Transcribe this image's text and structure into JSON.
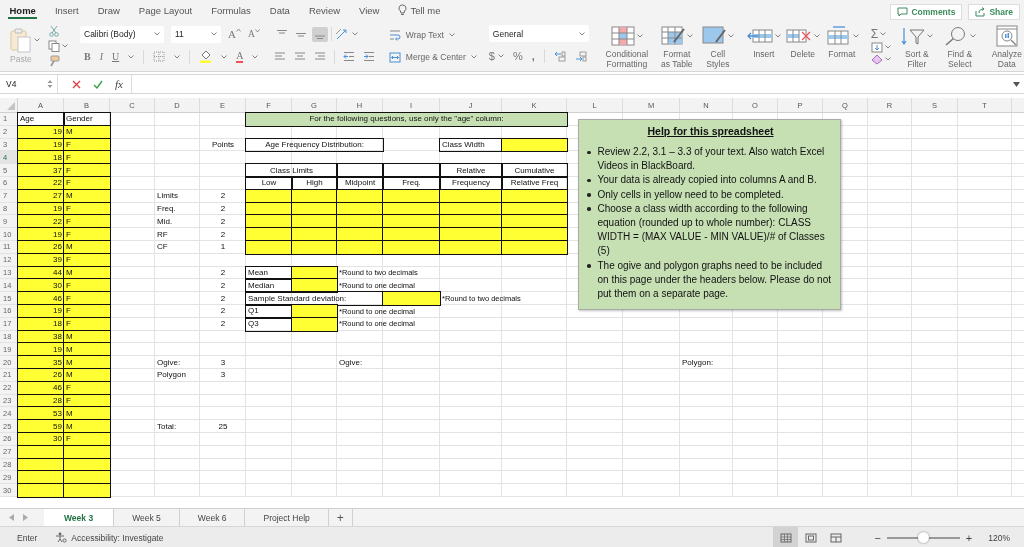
{
  "ribbon_tabs": [
    {
      "label": "Home",
      "kind": "tab",
      "selected": true
    },
    {
      "label": "Insert",
      "kind": "tab",
      "selected": false
    },
    {
      "label": "Draw",
      "kind": "tab",
      "selected": false
    },
    {
      "label": "Page Layout",
      "kind": "tab",
      "selected": false
    },
    {
      "label": "Formulas",
      "kind": "tab",
      "selected": false
    },
    {
      "label": "Data",
      "kind": "tab",
      "selected": false
    },
    {
      "label": "Review",
      "kind": "tab",
      "selected": false
    },
    {
      "label": "View",
      "kind": "tab",
      "selected": false
    },
    {
      "label": "Tell me",
      "kind": "search",
      "selected": false
    }
  ],
  "top_buttons": [
    {
      "label": "Comments",
      "kind": "comments"
    },
    {
      "label": "Share",
      "kind": "share"
    }
  ],
  "ribbon": {
    "paste": "Paste",
    "font_name": "Calibri (Body)",
    "font_size": "11",
    "increase_font": "A",
    "decrease_font": "A",
    "bold": "B",
    "italic": "I",
    "underline": "U",
    "font_color": "A",
    "vertical_align": [
      {
        "kind": "top",
        "selected": false
      },
      {
        "kind": "middle",
        "selected": false
      },
      {
        "kind": "bottom",
        "selected": true
      }
    ],
    "wrap_text": "Wrap Text",
    "merge_center": "Merge & Center",
    "number_format": "General",
    "currency": "$",
    "percent": "%",
    "comma": ",",
    "style_buttons": [
      {
        "label": "Conditional Formatting",
        "kind": "conditional"
      },
      {
        "label": "Format as Table",
        "kind": "table"
      },
      {
        "label": "Cell Styles",
        "kind": "styles"
      }
    ],
    "cell_buttons": [
      {
        "label": "Insert",
        "kind": "insert"
      },
      {
        "label": "Delete",
        "kind": "delete"
      },
      {
        "label": "Format",
        "kind": "format"
      }
    ],
    "autosum": "Σ",
    "edit_buttons": [
      {
        "label": "Sort & Filter",
        "kind": "sort"
      },
      {
        "label": "Find & Select",
        "kind": "find"
      }
    ],
    "analyze": "Analyze Data"
  },
  "formula_bar": {
    "name_box": "V4",
    "function_label": "fx"
  },
  "sheet": {
    "columns": [
      "A",
      "B",
      "C",
      "D",
      "E",
      "F",
      "G",
      "H",
      "I",
      "J",
      "K",
      "L",
      "M",
      "N",
      "O",
      "P",
      "Q",
      "R",
      "S",
      "T"
    ],
    "rows": [
      {
        "number": "1",
        "selected": false,
        "cells": [
          {
            "kind": "header",
            "text": "Age"
          },
          {
            "kind": "header",
            "text": "Gender"
          },
          "",
          "",
          "",
          {
            "kind": "banner",
            "text": "For the following questions, use only the \"age\" column:"
          },
          {
            "kind": "merged"
          },
          {
            "kind": "merged"
          },
          {
            "kind": "merged"
          },
          {
            "kind": "merged"
          },
          {
            "kind": "merged"
          }
        ]
      },
      {
        "number": "2",
        "selected": false,
        "cells": [
          {
            "kind": "entry",
            "text": "19"
          },
          {
            "kind": "entry-text",
            "text": "M"
          }
        ]
      },
      {
        "number": "3",
        "selected": false,
        "cells": [
          {
            "kind": "entry",
            "text": "19"
          },
          {
            "kind": "entry-text",
            "text": "F"
          },
          "",
          "",
          {
            "kind": "centered",
            "text": "Points"
          },
          {
            "kind": "box-center",
            "text": "Age Frequency Distribution:"
          },
          {
            "kind": "merged"
          },
          {
            "kind": "merged"
          },
          "",
          {
            "kind": "box",
            "text": "Class Width"
          },
          {
            "kind": "entry"
          }
        ]
      },
      {
        "number": "4",
        "selected": true,
        "cells": [
          {
            "kind": "entry",
            "text": "18"
          },
          {
            "kind": "entry-text",
            "text": "F"
          }
        ]
      },
      {
        "number": "5",
        "selected": false,
        "cells": [
          {
            "kind": "entry",
            "text": "37"
          },
          {
            "kind": "entry-text",
            "text": "F"
          },
          "",
          "",
          "",
          {
            "kind": "box-center",
            "text": "Class Limits"
          },
          {
            "kind": "merged"
          },
          {
            "kind": "box-center"
          },
          {
            "kind": "box-center"
          },
          {
            "kind": "box-center",
            "text": "Relative"
          },
          {
            "kind": "box-center",
            "text": "Cumulative"
          }
        ]
      },
      {
        "number": "6",
        "selected": false,
        "cells": [
          {
            "kind": "entry",
            "text": "22"
          },
          {
            "kind": "entry-text",
            "text": "F"
          },
          "",
          "",
          "",
          {
            "kind": "box-center",
            "text": "Low"
          },
          {
            "kind": "box-center",
            "text": "High"
          },
          {
            "kind": "box-center",
            "text": "Midpoint"
          },
          {
            "kind": "box-center",
            "text": "Freq."
          },
          {
            "kind": "box-center",
            "text": "Frequency"
          },
          {
            "kind": "box-center",
            "text": "Relative Freq"
          }
        ]
      },
      {
        "number": "7",
        "selected": false,
        "cells": [
          {
            "kind": "entry",
            "text": "27"
          },
          {
            "kind": "entry-text",
            "text": "M"
          },
          "",
          {
            "kind": "label",
            "text": "Limits"
          },
          {
            "kind": "centered",
            "text": "2"
          },
          {
            "kind": "entry"
          },
          {
            "kind": "entry"
          },
          {
            "kind": "entry"
          },
          {
            "kind": "entry"
          },
          {
            "kind": "entry"
          },
          {
            "kind": "entry"
          }
        ]
      },
      {
        "number": "8",
        "selected": false,
        "cells": [
          {
            "kind": "entry",
            "text": "19"
          },
          {
            "kind": "entry-text",
            "text": "F"
          },
          "",
          {
            "kind": "label",
            "text": "Freq."
          },
          {
            "kind": "centered",
            "text": "2"
          },
          {
            "kind": "entry"
          },
          {
            "kind": "entry"
          },
          {
            "kind": "entry"
          },
          {
            "kind": "entry"
          },
          {
            "kind": "entry"
          },
          {
            "kind": "entry"
          }
        ]
      },
      {
        "number": "9",
        "selected": false,
        "cells": [
          {
            "kind": "entry",
            "text": "22"
          },
          {
            "kind": "entry-text",
            "text": "F"
          },
          "",
          {
            "kind": "label",
            "text": "Mid."
          },
          {
            "kind": "centered",
            "text": "2"
          },
          {
            "kind": "entry"
          },
          {
            "kind": "entry"
          },
          {
            "kind": "entry"
          },
          {
            "kind": "entry"
          },
          {
            "kind": "entry"
          },
          {
            "kind": "entry"
          }
        ]
      },
      {
        "number": "10",
        "selected": false,
        "cells": [
          {
            "kind": "entry",
            "text": "19"
          },
          {
            "kind": "entry-text",
            "text": "F"
          },
          "",
          {
            "kind": "label",
            "text": "RF"
          },
          {
            "kind": "centered",
            "text": "2"
          },
          {
            "kind": "entry"
          },
          {
            "kind": "entry"
          },
          {
            "kind": "entry"
          },
          {
            "kind": "entry"
          },
          {
            "kind": "entry"
          },
          {
            "kind": "entry"
          }
        ]
      },
      {
        "number": "11",
        "selected": false,
        "cells": [
          {
            "kind": "entry",
            "text": "26"
          },
          {
            "kind": "entry-text",
            "text": "M"
          },
          "",
          {
            "kind": "label",
            "text": "CF"
          },
          {
            "kind": "centered",
            "text": "1"
          },
          {
            "kind": "entry"
          },
          {
            "kind": "entry"
          },
          {
            "kind": "entry"
          },
          {
            "kind": "entry"
          },
          {
            "kind": "entry"
          },
          {
            "kind": "entry"
          }
        ]
      },
      {
        "number": "12",
        "selected": false,
        "cells": [
          {
            "kind": "entry",
            "text": "39"
          },
          {
            "kind": "entry-text",
            "text": "F"
          }
        ]
      },
      {
        "number": "13",
        "selected": false,
        "cells": [
          {
            "kind": "entry",
            "text": "44"
          },
          {
            "kind": "entry-text",
            "text": "M"
          },
          "",
          "",
          {
            "kind": "centered",
            "text": "2"
          },
          {
            "kind": "box",
            "text": "Mean"
          },
          {
            "kind": "entry"
          },
          {
            "kind": "note",
            "text": "*Round to two decimals"
          },
          {
            "kind": "merged"
          }
        ]
      },
      {
        "number": "14",
        "selected": false,
        "cells": [
          {
            "kind": "entry",
            "text": "30"
          },
          {
            "kind": "entry-text",
            "text": "F"
          },
          "",
          "",
          {
            "kind": "centered",
            "text": "2"
          },
          {
            "kind": "box",
            "text": "Median"
          },
          {
            "kind": "entry"
          },
          {
            "kind": "note",
            "text": "*Round to one decimal"
          },
          {
            "kind": "merged"
          }
        ]
      },
      {
        "number": "15",
        "selected": false,
        "cells": [
          {
            "kind": "entry",
            "text": "46"
          },
          {
            "kind": "entry-text",
            "text": "F"
          },
          "",
          "",
          {
            "kind": "centered",
            "text": "2"
          },
          {
            "kind": "box",
            "text": "Sample Standard deviation:"
          },
          {
            "kind": "merged"
          },
          {
            "kind": "merged"
          },
          {
            "kind": "entry"
          },
          {
            "kind": "note",
            "text": "*Round to two decimals"
          },
          {
            "kind": "merged"
          }
        ]
      },
      {
        "number": "16",
        "selected": false,
        "cells": [
          {
            "kind": "entry",
            "text": "19"
          },
          {
            "kind": "entry-text",
            "text": "F"
          },
          "",
          "",
          {
            "kind": "centered",
            "text": "2"
          },
          {
            "kind": "box",
            "text": "Q1"
          },
          {
            "kind": "entry"
          },
          {
            "kind": "note",
            "text": "*Round to one decimal"
          },
          {
            "kind": "merged"
          }
        ]
      },
      {
        "number": "17",
        "selected": false,
        "cells": [
          {
            "kind": "entry",
            "text": "18"
          },
          {
            "kind": "entry-text",
            "text": "F"
          },
          "",
          "",
          {
            "kind": "centered",
            "text": "2"
          },
          {
            "kind": "box",
            "text": "Q3"
          },
          {
            "kind": "entry"
          },
          {
            "kind": "note",
            "text": "*Round to one decimal"
          },
          {
            "kind": "merged"
          }
        ]
      },
      {
        "number": "18",
        "selected": false,
        "cells": [
          {
            "kind": "entry",
            "text": "38"
          },
          {
            "kind": "entry-text",
            "text": "M"
          }
        ]
      },
      {
        "number": "19",
        "selected": false,
        "cells": [
          {
            "kind": "entry",
            "text": "19"
          },
          {
            "kind": "entry-text",
            "text": "M"
          }
        ]
      },
      {
        "number": "20",
        "selected": false,
        "cells": [
          {
            "kind": "entry",
            "text": "35"
          },
          {
            "kind": "entry-text",
            "text": "M"
          },
          "",
          {
            "kind": "label",
            "text": "Ogive:"
          },
          {
            "kind": "centered",
            "text": "3"
          },
          "",
          "",
          {
            "kind": "label",
            "text": "Ogive:"
          },
          "",
          "",
          "",
          "",
          "",
          {
            "kind": "label",
            "text": "Polygon:"
          }
        ]
      },
      {
        "number": "21",
        "selected": false,
        "cells": [
          {
            "kind": "entry",
            "text": "26"
          },
          {
            "kind": "entry-text",
            "text": "M"
          },
          "",
          {
            "kind": "label",
            "text": "Polygon"
          },
          {
            "kind": "centered",
            "text": "3"
          }
        ]
      },
      {
        "number": "22",
        "selected": false,
        "cells": [
          {
            "kind": "entry",
            "text": "46"
          },
          {
            "kind": "entry-text",
            "text": "F"
          }
        ]
      },
      {
        "number": "23",
        "selected": false,
        "cells": [
          {
            "kind": "entry",
            "text": "28"
          },
          {
            "kind": "entry-text",
            "text": "F"
          }
        ]
      },
      {
        "number": "24",
        "selected": false,
        "cells": [
          {
            "kind": "entry",
            "text": "53"
          },
          {
            "kind": "entry-text",
            "text": "M"
          }
        ]
      },
      {
        "number": "25",
        "selected": false,
        "cells": [
          {
            "kind": "entry",
            "text": "59"
          },
          {
            "kind": "entry-text",
            "text": "M"
          },
          "",
          {
            "kind": "label",
            "text": "Total:"
          },
          {
            "kind": "centered",
            "text": "25"
          }
        ]
      },
      {
        "number": "26",
        "selected": false,
        "cells": [
          {
            "kind": "entry",
            "text": "30"
          },
          {
            "kind": "entry-text",
            "text": "F"
          }
        ]
      },
      {
        "number": "27",
        "selected": false,
        "cells": [
          {
            "kind": "entry"
          },
          {
            "kind": "entry-text"
          }
        ]
      },
      {
        "number": "28",
        "selected": false,
        "cells": [
          {
            "kind": "entry"
          },
          {
            "kind": "entry-text"
          }
        ]
      },
      {
        "number": "29",
        "selected": false,
        "cells": [
          {
            "kind": "entry"
          },
          {
            "kind": "entry-text"
          }
        ]
      },
      {
        "number": "30",
        "selected": false,
        "cells": [
          {
            "kind": "entry"
          },
          {
            "kind": "entry-text"
          }
        ]
      }
    ]
  },
  "help_box": {
    "title": "Help for this spreadsheet",
    "bullets": [
      "Review 2.2, 3.1 – 3.3 of your text. Also watch Excel Videos in BlackBoard.",
      "Your data is already copied into columns A and B.",
      "Only cells in yellow need to be completed.",
      "Choose a class width according to the following equation (rounded up to whole number): CLASS WIDTH = (MAX VALUE - MIN VALUE)/# of Classes (5)",
      "The ogive and polygon graphs need to be included on this page under the headers below. Please do not put them on a separate page."
    ]
  },
  "sheet_tabs": [
    {
      "label": "Week 3",
      "selected": true
    },
    {
      "label": "Week 5",
      "selected": false
    },
    {
      "label": "Week 6",
      "selected": false
    },
    {
      "label": "Project Help",
      "selected": false
    }
  ],
  "add_sheet": "+",
  "status_bar": {
    "mode": "Enter",
    "accessibility": "Accessibility: Investigate",
    "views": [
      {
        "kind": "normal",
        "selected": true
      },
      {
        "kind": "page-layout",
        "selected": false
      },
      {
        "kind": "page-break",
        "selected": false
      }
    ],
    "zoom_out": "−",
    "zoom": {
      "level": 0.5
    },
    "zoom_in": "+",
    "zoom_percent": "120%"
  }
}
